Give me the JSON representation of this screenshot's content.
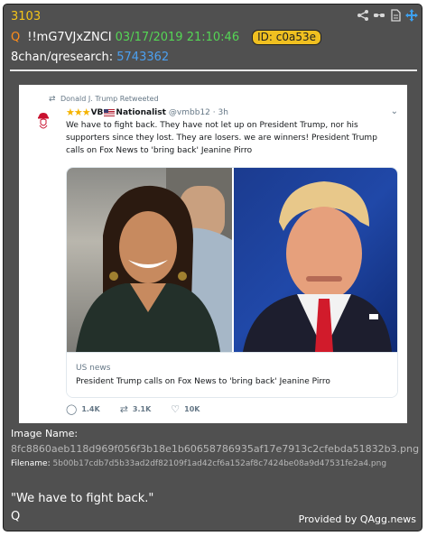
{
  "post": {
    "number": "3103",
    "q_marker": "Q",
    "tripcode": "!!mG7VJxZNCI",
    "datetime": "03/17/2019 21:10:46",
    "id_badge": "ID: c0a53e",
    "board": "8chan/qresearch:",
    "ref": "5743362"
  },
  "tweet": {
    "retweeted_by": "Donald J. Trump Retweeted",
    "name": "VB",
    "name2": "Nationalist",
    "handle": "@vmbb12 · 3h",
    "text": "We have to fight back. They have not let up on President Trump, nor his supporters since they lost. They are losers. we are winners! President Trump calls on Fox News to 'bring back' Jeanine Pirro",
    "card_source": "US news",
    "card_title": "President Trump calls on Fox News to 'bring back' Jeanine Pirro",
    "replies": "1.4K",
    "retweets": "3.1K",
    "likes": "10K"
  },
  "meta": {
    "image_name_label": "Image Name:",
    "image_name": "8fc8860aeb118d969f056f3b18e1b60658786935af17e7913c2cfebda51832b3.png",
    "filename_label": "Filename:",
    "filename": "5b00b17cdb7d5b33ad2df82109f1ad42cf6a152af8c7424be08a9d47531fe2a4.png"
  },
  "message": {
    "quote": "\"We have to fight back.\"",
    "signature": "Q",
    "provided_by": "Provided by QAgg.news"
  },
  "icons": [
    "share-icon",
    "glasses-icon",
    "document-icon",
    "move-icon"
  ],
  "colors": {
    "card_bg": "#505050",
    "post_number": "#f5c518",
    "date": "#55d655",
    "link": "#4ca0f0",
    "badge": "#f0c020"
  }
}
